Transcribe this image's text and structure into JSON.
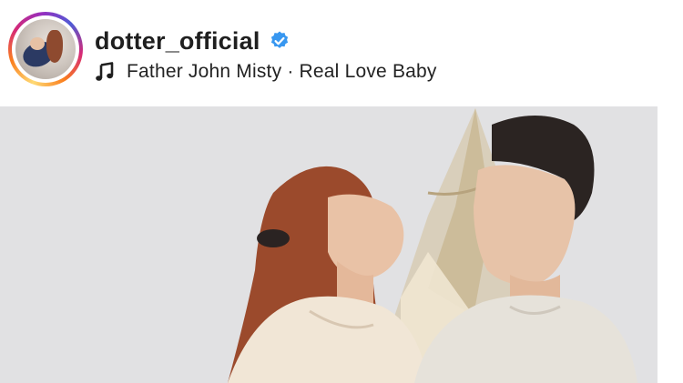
{
  "post": {
    "username": "dotter_official",
    "verified": true,
    "audio": {
      "text": "Father John Misty · Real Love Baby"
    }
  },
  "icons": {
    "verified": "verified-badge-icon",
    "music": "music-note-icon"
  },
  "colors": {
    "verified_blue": "#3897f0",
    "story_ring": [
      "#feda75",
      "#fa7e1e",
      "#d62976",
      "#962fbf",
      "#4f5bd5"
    ],
    "text": "#1f1f1f"
  }
}
